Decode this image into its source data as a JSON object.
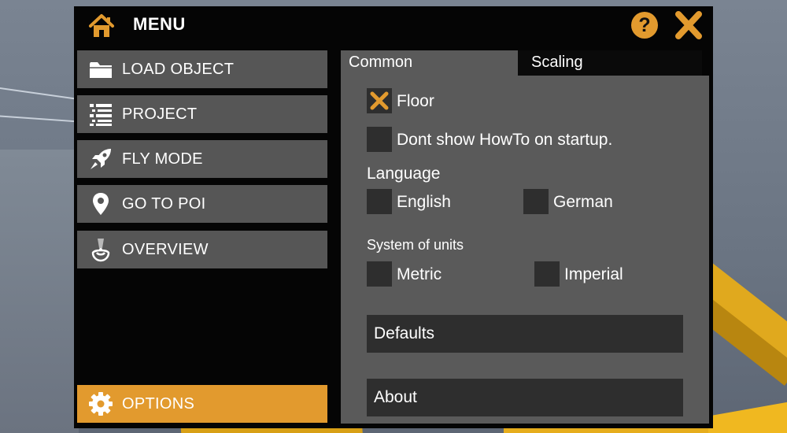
{
  "header": {
    "title": "MENU",
    "help_label": "?",
    "icons": {
      "home": "home-icon",
      "help": "help-icon",
      "close": "close-icon"
    }
  },
  "sidebar": {
    "items": [
      {
        "label": "LOAD OBJECT",
        "icon": "folder-icon",
        "active": false
      },
      {
        "label": "PROJECT",
        "icon": "list-icon",
        "active": false
      },
      {
        "label": "FLY MODE",
        "icon": "rocket-icon",
        "active": false
      },
      {
        "label": "GO TO POI",
        "icon": "location-pin-icon",
        "active": false
      },
      {
        "label": "OVERVIEW",
        "icon": "overview-icon",
        "active": false
      }
    ],
    "options": {
      "label": "OPTIONS",
      "icon": "gear-icon",
      "active": true
    }
  },
  "tabs": [
    {
      "label": "Common",
      "selected": true
    },
    {
      "label": "Scaling",
      "selected": false
    }
  ],
  "common": {
    "floor": {
      "label": "Floor",
      "checked": true
    },
    "howto": {
      "label": "Dont show HowTo on startup.",
      "checked": false
    },
    "language": {
      "title": "Language",
      "options": [
        {
          "label": "English",
          "checked": false
        },
        {
          "label": "German",
          "checked": false
        }
      ]
    },
    "units": {
      "title": "System of units",
      "options": [
        {
          "label": "Metric",
          "checked": false
        },
        {
          "label": "Imperial",
          "checked": false
        }
      ]
    },
    "defaults_label": "Defaults",
    "about_label": "About"
  },
  "colors": {
    "accent": "#e29a2e",
    "window_bg": "#050505",
    "sidebar_item": "#565656",
    "panel_bg": "#5a5a5a",
    "control_bg": "#2e2e2e"
  }
}
